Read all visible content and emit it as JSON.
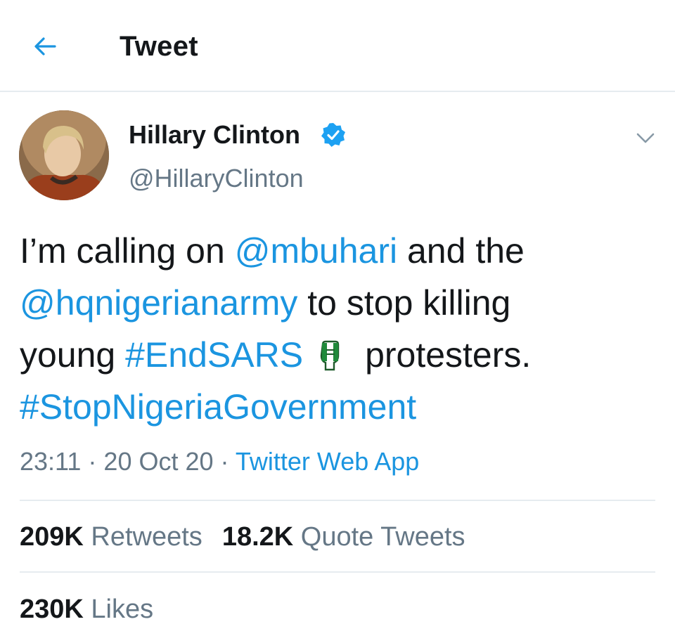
{
  "header": {
    "title": "Tweet",
    "back_icon": "arrow-left-icon"
  },
  "author": {
    "name": "Hillary Clinton",
    "handle": "@HillaryClinton",
    "verified_icon": "verified-badge-icon"
  },
  "tweet": {
    "text_1": "I’m calling on ",
    "mention_1": "@mbuhari",
    "text_2": " and the",
    "mention_2": "@hqnigerianarmy",
    "text_3": " to stop killing",
    "text_4": "young ",
    "hashtag_1": "#EndSARS",
    "emoji": "nigeria-flag-fist-icon",
    "text_5": "protesters.",
    "hashtag_2": "#StopNigeriaGovernment"
  },
  "meta": {
    "time": "23:11",
    "sep_1": " · ",
    "date": "20 Oct 20",
    "sep_2": " · ",
    "source": "Twitter Web App"
  },
  "stats": {
    "retweets_count": "209K",
    "retweets_label": " Retweets",
    "quotes_count": "18.2K",
    "quotes_label": " Quote Tweets",
    "likes_count": "230K",
    "likes_label": " Likes"
  },
  "colors": {
    "link": "#1b95e0",
    "muted": "#657786",
    "text": "#14171a",
    "divider": "#e6ecf0"
  }
}
